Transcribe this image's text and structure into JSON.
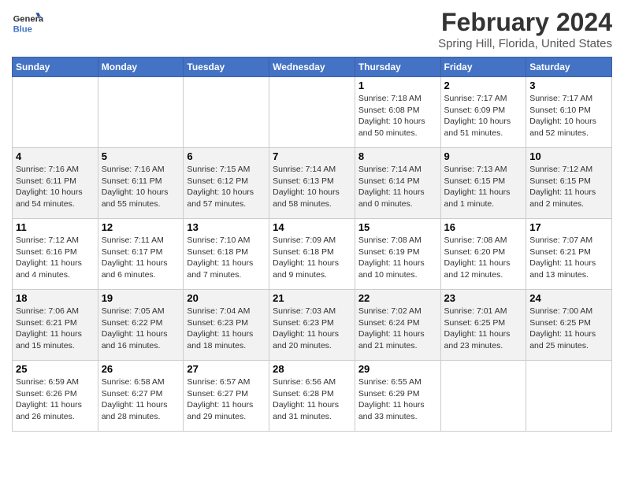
{
  "header": {
    "logo_line1": "General",
    "logo_line2": "Blue",
    "title": "February 2024",
    "subtitle": "Spring Hill, Florida, United States"
  },
  "days_of_week": [
    "Sunday",
    "Monday",
    "Tuesday",
    "Wednesday",
    "Thursday",
    "Friday",
    "Saturday"
  ],
  "weeks": [
    [
      {
        "day": "",
        "content": ""
      },
      {
        "day": "",
        "content": ""
      },
      {
        "day": "",
        "content": ""
      },
      {
        "day": "",
        "content": ""
      },
      {
        "day": "1",
        "content": "Sunrise: 7:18 AM\nSunset: 6:08 PM\nDaylight: 10 hours\nand 50 minutes."
      },
      {
        "day": "2",
        "content": "Sunrise: 7:17 AM\nSunset: 6:09 PM\nDaylight: 10 hours\nand 51 minutes."
      },
      {
        "day": "3",
        "content": "Sunrise: 7:17 AM\nSunset: 6:10 PM\nDaylight: 10 hours\nand 52 minutes."
      }
    ],
    [
      {
        "day": "4",
        "content": "Sunrise: 7:16 AM\nSunset: 6:11 PM\nDaylight: 10 hours\nand 54 minutes."
      },
      {
        "day": "5",
        "content": "Sunrise: 7:16 AM\nSunset: 6:11 PM\nDaylight: 10 hours\nand 55 minutes."
      },
      {
        "day": "6",
        "content": "Sunrise: 7:15 AM\nSunset: 6:12 PM\nDaylight: 10 hours\nand 57 minutes."
      },
      {
        "day": "7",
        "content": "Sunrise: 7:14 AM\nSunset: 6:13 PM\nDaylight: 10 hours\nand 58 minutes."
      },
      {
        "day": "8",
        "content": "Sunrise: 7:14 AM\nSunset: 6:14 PM\nDaylight: 11 hours\nand 0 minutes."
      },
      {
        "day": "9",
        "content": "Sunrise: 7:13 AM\nSunset: 6:15 PM\nDaylight: 11 hours\nand 1 minute."
      },
      {
        "day": "10",
        "content": "Sunrise: 7:12 AM\nSunset: 6:15 PM\nDaylight: 11 hours\nand 2 minutes."
      }
    ],
    [
      {
        "day": "11",
        "content": "Sunrise: 7:12 AM\nSunset: 6:16 PM\nDaylight: 11 hours\nand 4 minutes."
      },
      {
        "day": "12",
        "content": "Sunrise: 7:11 AM\nSunset: 6:17 PM\nDaylight: 11 hours\nand 6 minutes."
      },
      {
        "day": "13",
        "content": "Sunrise: 7:10 AM\nSunset: 6:18 PM\nDaylight: 11 hours\nand 7 minutes."
      },
      {
        "day": "14",
        "content": "Sunrise: 7:09 AM\nSunset: 6:18 PM\nDaylight: 11 hours\nand 9 minutes."
      },
      {
        "day": "15",
        "content": "Sunrise: 7:08 AM\nSunset: 6:19 PM\nDaylight: 11 hours\nand 10 minutes."
      },
      {
        "day": "16",
        "content": "Sunrise: 7:08 AM\nSunset: 6:20 PM\nDaylight: 11 hours\nand 12 minutes."
      },
      {
        "day": "17",
        "content": "Sunrise: 7:07 AM\nSunset: 6:21 PM\nDaylight: 11 hours\nand 13 minutes."
      }
    ],
    [
      {
        "day": "18",
        "content": "Sunrise: 7:06 AM\nSunset: 6:21 PM\nDaylight: 11 hours\nand 15 minutes."
      },
      {
        "day": "19",
        "content": "Sunrise: 7:05 AM\nSunset: 6:22 PM\nDaylight: 11 hours\nand 16 minutes."
      },
      {
        "day": "20",
        "content": "Sunrise: 7:04 AM\nSunset: 6:23 PM\nDaylight: 11 hours\nand 18 minutes."
      },
      {
        "day": "21",
        "content": "Sunrise: 7:03 AM\nSunset: 6:23 PM\nDaylight: 11 hours\nand 20 minutes."
      },
      {
        "day": "22",
        "content": "Sunrise: 7:02 AM\nSunset: 6:24 PM\nDaylight: 11 hours\nand 21 minutes."
      },
      {
        "day": "23",
        "content": "Sunrise: 7:01 AM\nSunset: 6:25 PM\nDaylight: 11 hours\nand 23 minutes."
      },
      {
        "day": "24",
        "content": "Sunrise: 7:00 AM\nSunset: 6:25 PM\nDaylight: 11 hours\nand 25 minutes."
      }
    ],
    [
      {
        "day": "25",
        "content": "Sunrise: 6:59 AM\nSunset: 6:26 PM\nDaylight: 11 hours\nand 26 minutes."
      },
      {
        "day": "26",
        "content": "Sunrise: 6:58 AM\nSunset: 6:27 PM\nDaylight: 11 hours\nand 28 minutes."
      },
      {
        "day": "27",
        "content": "Sunrise: 6:57 AM\nSunset: 6:27 PM\nDaylight: 11 hours\nand 29 minutes."
      },
      {
        "day": "28",
        "content": "Sunrise: 6:56 AM\nSunset: 6:28 PM\nDaylight: 11 hours\nand 31 minutes."
      },
      {
        "day": "29",
        "content": "Sunrise: 6:55 AM\nSunset: 6:29 PM\nDaylight: 11 hours\nand 33 minutes."
      },
      {
        "day": "",
        "content": ""
      },
      {
        "day": "",
        "content": ""
      }
    ]
  ]
}
